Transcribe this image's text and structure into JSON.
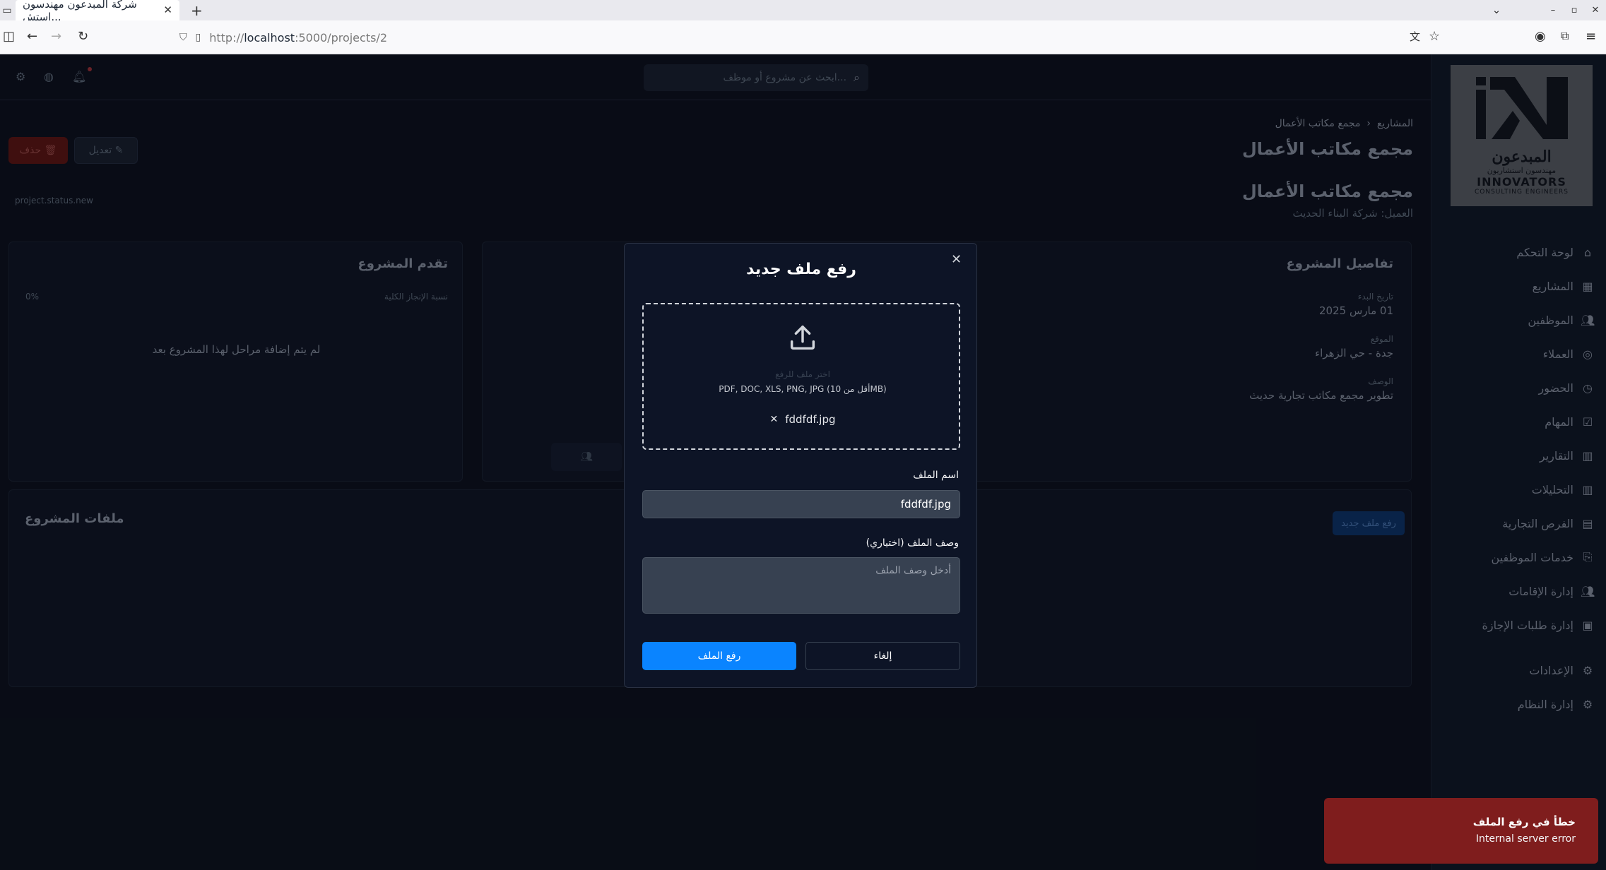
{
  "browser": {
    "tab_title": "شركة المبدعون مهندسون استش...",
    "url_prefix": "http://",
    "url_host": "localhost",
    "url_path": ":5000/projects/2"
  },
  "app": {
    "search_placeholder": "ابحث عن مشروع أو موظف...",
    "logo": {
      "arabic": "المبدعون",
      "arabic_sub": "مهندسون استشاريون",
      "english": "INNOVATORS",
      "english_sub": "CONSULTING ENGINEERS"
    },
    "sidebar": [
      {
        "label": "لوحة التحكم",
        "icon": "home-icon"
      },
      {
        "label": "المشاريع",
        "icon": "grid-icon"
      },
      {
        "label": "الموظفين",
        "icon": "users-icon"
      },
      {
        "label": "العملاء",
        "icon": "user-circle-icon"
      },
      {
        "label": "الحضور",
        "icon": "clock-icon"
      },
      {
        "label": "المهام",
        "icon": "check-square-icon"
      },
      {
        "label": "التقارير",
        "icon": "bar-chart-icon"
      },
      {
        "label": "التحليلات",
        "icon": "bar-chart-icon"
      },
      {
        "label": "الفرص التجارية",
        "icon": "building-icon"
      },
      {
        "label": "خدمات الموظفين",
        "icon": "id-card-icon"
      },
      {
        "label": "إدارة الإقامات",
        "icon": "users-icon"
      },
      {
        "label": "إدارة طلبات الإجازة",
        "icon": "calendar-icon"
      },
      {
        "label": "الإعدادات",
        "icon": "gear-icon"
      },
      {
        "label": "إدارة النظام",
        "icon": "gear-icon"
      }
    ],
    "breadcrumb": {
      "root": "المشاريع",
      "current": "مجمع مكاتب الأعمال"
    },
    "page_title": "مجمع مكاتب الأعمال",
    "edit_label": "تعديل",
    "delete_label": "حذف",
    "status": "project.status.new",
    "project_title": "مجمع مكاتب الأعمال",
    "client": "العميل: شركة البناء الحديث",
    "details": {
      "heading": "تفاصيل المشروع",
      "start_label": "تاريخ البدء",
      "start_value": "01 مارس 2025",
      "location_label": "الموقع",
      "location_value": "جدة - حي الزهراء",
      "desc_label": "الوصف",
      "desc_value": "تطوير مجمع مكاتب تجارية حديث"
    },
    "progress": {
      "heading": "تقدم المشروع",
      "overall_label": "نسبة الإنجاز الكلية",
      "overall_value": "0%",
      "empty": "لم يتم إضافة مراحل لهذا المشروع بعد"
    },
    "files": {
      "heading": "ملفات المشروع",
      "upload_new": "رفع ملف جديد"
    }
  },
  "modal": {
    "title": "رفع ملف جديد",
    "drop_hint": "اختر ملف للرفع",
    "types": "PDF, DOC, XLS, PNG, JPG (أقل من 10MB)",
    "selected_file": "fddfdf.jpg",
    "name_label": "اسم الملف",
    "name_value": "fddfdf.jpg",
    "desc_label": "وصف الملف (اختياري)",
    "desc_placeholder": "أدخل وصف الملف",
    "upload_button": "رفع الملف",
    "cancel_button": "إلغاء"
  },
  "toast": {
    "title": "خطأ في رفع الملف",
    "message": "Internal server error"
  }
}
